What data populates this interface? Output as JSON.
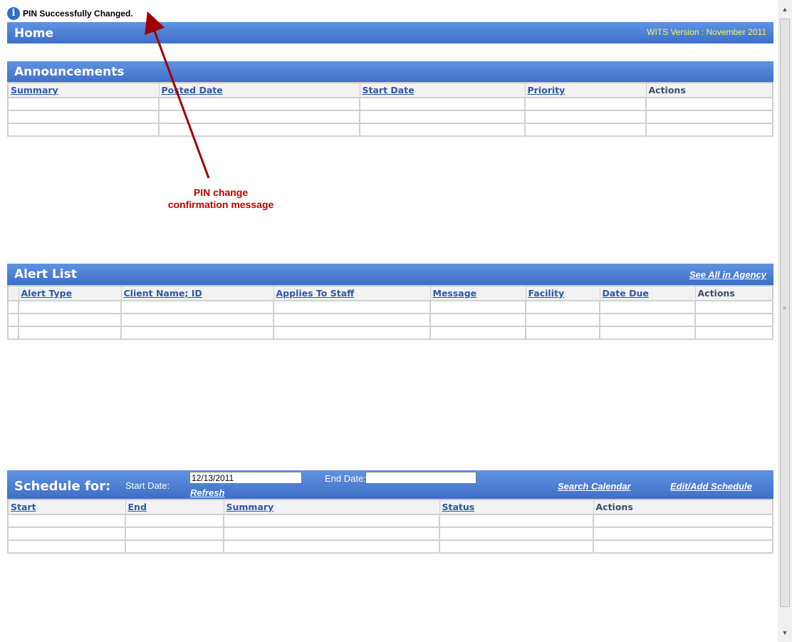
{
  "message": {
    "icon": "info-icon",
    "text": "PIN Successfully Changed."
  },
  "home": {
    "title": "Home",
    "version": "WITS Version : November 2011"
  },
  "announcements": {
    "title": "Announcements",
    "columns": [
      "Summary",
      "Posted Date",
      "Start Date",
      "Priority",
      "Actions"
    ]
  },
  "annotation": {
    "line1": "PIN change",
    "line2": "confirmation message"
  },
  "alerts": {
    "title": "Alert List",
    "see_all": "See All in Agency",
    "columns": [
      "Alert Type",
      "Client Name; ID",
      "Applies To Staff",
      "Message",
      "Facility",
      "Date Due",
      "Actions"
    ]
  },
  "schedule": {
    "title": "Schedule for:",
    "start_label": "Start Date:",
    "start_value": "12/13/2011",
    "end_label": "End Date:",
    "end_value": "",
    "refresh": "Refresh",
    "search_calendar": "Search Calendar",
    "edit_add": "Edit/Add Schedule",
    "columns": [
      "Start",
      "End",
      "Summary",
      "Status",
      "Actions"
    ]
  },
  "colors": {
    "header": "#3d6fc8",
    "version_text": "#f3f36a",
    "link": "#2f58a6",
    "annotation": "#c00000"
  }
}
